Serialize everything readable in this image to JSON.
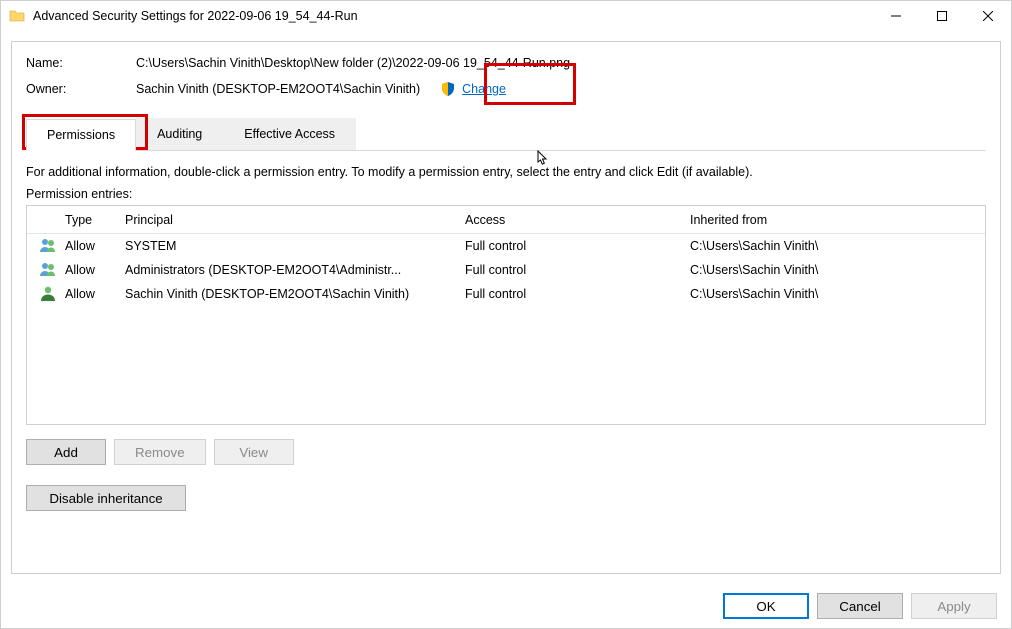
{
  "window": {
    "title": "Advanced Security Settings for 2022-09-06 19_54_44-Run"
  },
  "details": {
    "name_label": "Name:",
    "name_value": "C:\\Users\\Sachin Vinith\\Desktop\\New folder (2)\\2022-09-06 19_54_44-Run.png",
    "owner_label": "Owner:",
    "owner_value": "Sachin Vinith (DESKTOP-EM2OOT4\\Sachin Vinith)",
    "change_link": "Change"
  },
  "tabs": {
    "permissions": "Permissions",
    "auditing": "Auditing",
    "effective": "Effective Access"
  },
  "info_text": "For additional information, double-click a permission entry. To modify a permission entry, select the entry and click Edit (if available).",
  "entries_label": "Permission entries:",
  "columns": {
    "type": "Type",
    "principal": "Principal",
    "access": "Access",
    "inherited": "Inherited from"
  },
  "entries": [
    {
      "icon": "group",
      "type": "Allow",
      "principal": "SYSTEM",
      "access": "Full control",
      "inherited": "C:\\Users\\Sachin Vinith\\"
    },
    {
      "icon": "group",
      "type": "Allow",
      "principal": "Administrators (DESKTOP-EM2OOT4\\Administr...",
      "access": "Full control",
      "inherited": "C:\\Users\\Sachin Vinith\\"
    },
    {
      "icon": "user",
      "type": "Allow",
      "principal": "Sachin Vinith (DESKTOP-EM2OOT4\\Sachin Vinith)",
      "access": "Full control",
      "inherited": "C:\\Users\\Sachin Vinith\\"
    }
  ],
  "buttons": {
    "add": "Add",
    "remove": "Remove",
    "view": "View",
    "disable_inheritance": "Disable inheritance",
    "ok": "OK",
    "cancel": "Cancel",
    "apply": "Apply"
  }
}
